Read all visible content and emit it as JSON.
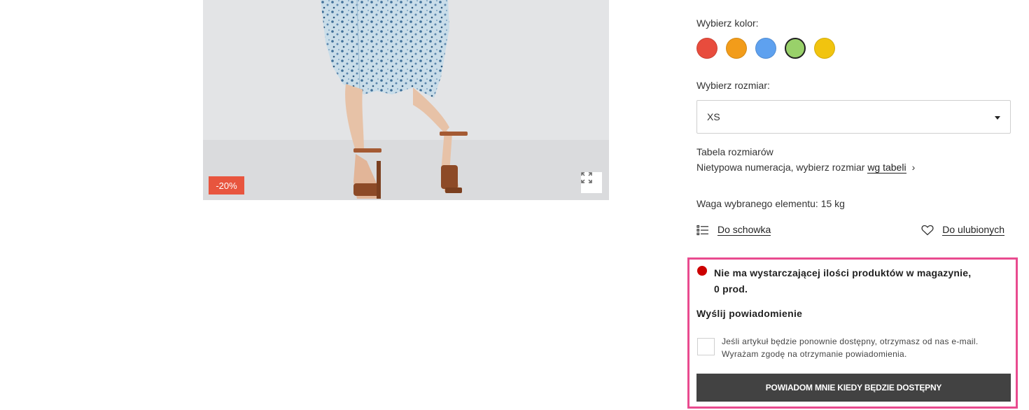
{
  "product_image": {
    "discount_badge": "-20%"
  },
  "color": {
    "label": "Wybierz kolor:",
    "swatches": [
      {
        "name": "red",
        "hex": "#e84c3d",
        "selected": false
      },
      {
        "name": "orange",
        "hex": "#f29c1a",
        "selected": false
      },
      {
        "name": "blue",
        "hex": "#5ea1ef",
        "selected": false
      },
      {
        "name": "green",
        "hex": "#99d16a",
        "selected": true
      },
      {
        "name": "yellow",
        "hex": "#f1c40f",
        "selected": false
      }
    ]
  },
  "size": {
    "label": "Wybierz rozmiar:",
    "selected_value": "XS"
  },
  "size_table": {
    "title": "Tabela rozmiarów",
    "text": "Nietypowa numeracja, wybierz rozmiar",
    "link_text": "wg tabeli"
  },
  "weight_text": "Waga wybranego elementu: 15 kg",
  "actions": {
    "clipboard_label": "Do schowka",
    "favorites_label": "Do ulubionych"
  },
  "notify": {
    "stock_line1": "Nie ma wystarczającej ilości produktów w magazynie,",
    "stock_line2": "0 prod.",
    "title": "Wyślij powiadomienie",
    "consent_line1": "Jeśli artykuł będzie ponownie dostępny, otrzymasz od nas e-mail.",
    "consent_line2": "Wyrażam zgodę na otrzymanie powiadomienia.",
    "button_label": "POWIADOM MNIE KIEDY BĘDZIE DOSTĘPNY",
    "status_color": "#cc0000",
    "highlight_color": "#e94b8f"
  }
}
